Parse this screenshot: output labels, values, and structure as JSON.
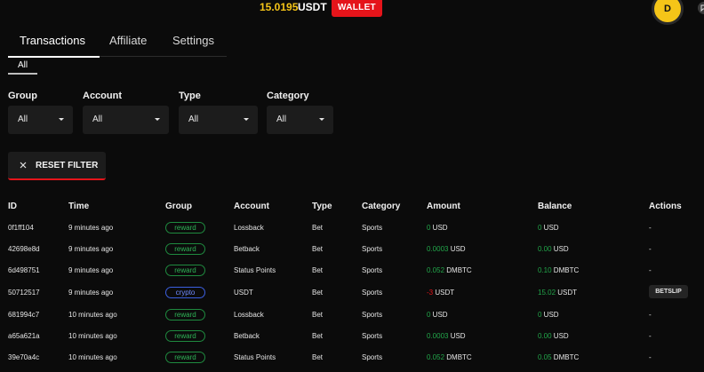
{
  "header": {
    "balance_amount": "15.0195",
    "balance_currency": "USDT",
    "wallet_label": "WALLET",
    "avatar_initial": "D"
  },
  "tabs": [
    {
      "label": "Transactions",
      "active": true
    },
    {
      "label": "Affiliate",
      "active": false
    },
    {
      "label": "Settings",
      "active": false
    }
  ],
  "subtab": {
    "label": "All"
  },
  "filters": [
    {
      "label": "Group",
      "value": "All"
    },
    {
      "label": "Account",
      "value": "All"
    },
    {
      "label": "Type",
      "value": "All"
    },
    {
      "label": "Category",
      "value": "All"
    }
  ],
  "reset_label": "RESET FILTER",
  "table": {
    "headers": [
      "ID",
      "Time",
      "Group",
      "Account",
      "Type",
      "Category",
      "Amount",
      "Balance",
      "Actions"
    ],
    "rows": [
      {
        "id": "0f1ff104",
        "time": "9 minutes ago",
        "group": "reward",
        "account": "Lossback",
        "type": "Bet",
        "category": "Sports",
        "amount_prefix": "0",
        "amount_rest": " USD",
        "balance_prefix": "0",
        "balance_rest": " USD",
        "action": "-"
      },
      {
        "id": "42698e8d",
        "time": "9 minutes ago",
        "group": "reward",
        "account": "Betback",
        "type": "Bet",
        "category": "Sports",
        "amount_prefix": "0.0003",
        "amount_rest": " USD",
        "balance_prefix": "0.00",
        "balance_rest": " USD",
        "action": "-"
      },
      {
        "id": "6d498751",
        "time": "9 minutes ago",
        "group": "reward",
        "account": "Status Points",
        "type": "Bet",
        "category": "Sports",
        "amount_prefix": "0.052",
        "amount_rest": " DMBTC",
        "balance_prefix": "0.10",
        "balance_rest": " DMBTC",
        "action": "-"
      },
      {
        "id": "50712517",
        "time": "9 minutes ago",
        "group": "crypto",
        "account": "USDT",
        "type": "Bet",
        "category": "Sports",
        "amount_prefix": "-3",
        "amount_rest": " USDT",
        "balance_prefix": "15.02",
        "balance_rest": " USDT",
        "action": "BETSLIP"
      },
      {
        "id": "681994c7",
        "time": "10 minutes ago",
        "group": "reward",
        "account": "Lossback",
        "type": "Bet",
        "category": "Sports",
        "amount_prefix": "0",
        "amount_rest": " USD",
        "balance_prefix": "0",
        "balance_rest": " USD",
        "action": "-"
      },
      {
        "id": "a65a621a",
        "time": "10 minutes ago",
        "group": "reward",
        "account": "Betback",
        "type": "Bet",
        "category": "Sports",
        "amount_prefix": "0.0003",
        "amount_rest": " USD",
        "balance_prefix": "0.00",
        "balance_rest": " USD",
        "action": "-"
      },
      {
        "id": "39e70a4c",
        "time": "10 minutes ago",
        "group": "reward",
        "account": "Status Points",
        "type": "Bet",
        "category": "Sports",
        "amount_prefix": "0.052",
        "amount_rest": " DMBTC",
        "balance_prefix": "0.05",
        "balance_rest": " DMBTC",
        "action": "-"
      }
    ]
  },
  "colors": {
    "accent_red": "#e5141a",
    "accent_yellow": "#f5c518",
    "positive_green": "#22a64a",
    "crypto_blue": "#3b5fe0"
  },
  "icons": {
    "chat": "chat-icon",
    "reset": "close-icon",
    "dropdown": "chevron-down-icon"
  }
}
